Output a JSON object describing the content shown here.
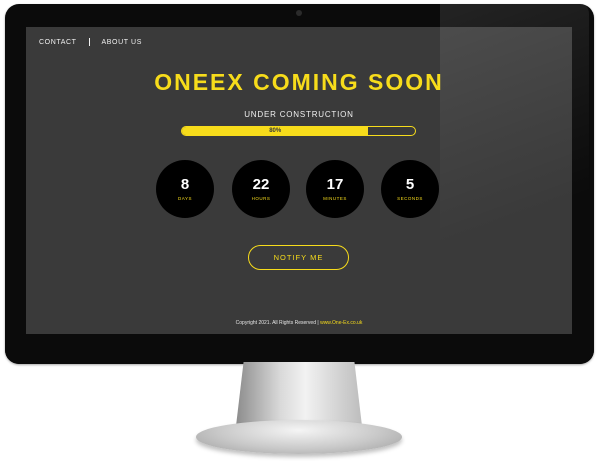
{
  "nav": {
    "contact": "CONTACT",
    "separator": "|",
    "about": "ABOUT US"
  },
  "hero": {
    "title": "ONEEX COMING SOON",
    "subtitle": "UNDER CONSTRUCTION"
  },
  "progress": {
    "value": 0.8,
    "label": "80%"
  },
  "countdown": [
    {
      "value": "8",
      "unit": "DAYS"
    },
    {
      "value": "22",
      "unit": "HOURS"
    },
    {
      "value": "17",
      "unit": "MINUTES"
    },
    {
      "value": "5",
      "unit": "SECONDS"
    }
  ],
  "notify": {
    "label": "NOTIFY ME"
  },
  "footer": {
    "copyright": "Copyright 2021. All Rights Reserved",
    "separator": "|",
    "link": "www.One-Ex.co.uk"
  },
  "colors": {
    "accent": "#f7dc1b",
    "screen_bg": "#3a3a3a",
    "circle_bg": "#000000"
  }
}
